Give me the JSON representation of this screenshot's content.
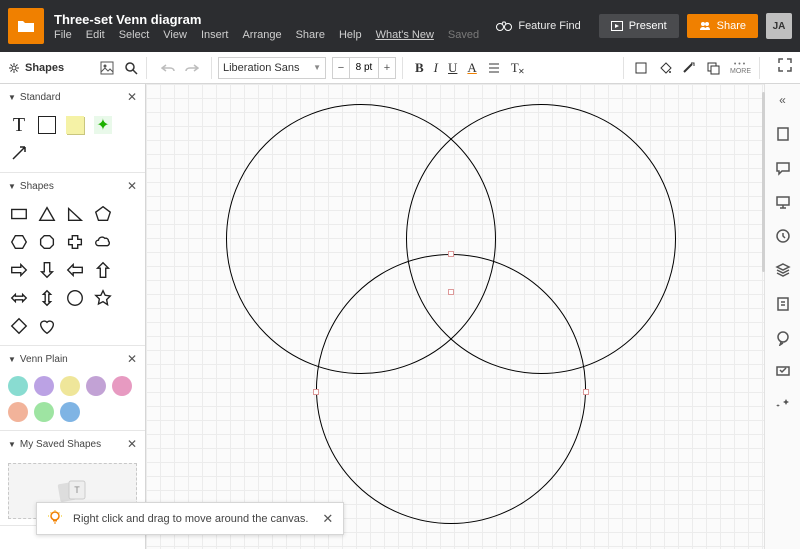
{
  "header": {
    "title": "Three-set Venn diagram",
    "menu": [
      "File",
      "Edit",
      "Select",
      "View",
      "Insert",
      "Arrange",
      "Share",
      "Help",
      "What's New",
      "Saved"
    ],
    "feature_find": "Feature Find",
    "present": "Present",
    "share": "Share",
    "avatar": "JA"
  },
  "toolbar": {
    "shapes_label": "Shapes",
    "font": "Liberation Sans",
    "font_size": "8 pt",
    "minus": "−",
    "plus": "+",
    "more": "MORE"
  },
  "panels": {
    "standard": {
      "title": "Standard",
      "t": "T"
    },
    "shapes": {
      "title": "Shapes"
    },
    "venn": {
      "title": "Venn Plain",
      "colors": [
        "#89dcd1",
        "#bba2e4",
        "#efe69a",
        "#c2a2d5",
        "#e79ac1",
        "#f2b39a",
        "#9ee4a2",
        "#7fb4e4"
      ]
    },
    "saved": {
      "title": "My Saved Shapes"
    }
  },
  "tip": "Right click and drag to move around the canvas.",
  "chart_data": {
    "type": "venn",
    "sets": 3,
    "set_labels": [
      "",
      "",
      ""
    ],
    "title": "Three-set Venn diagram"
  }
}
